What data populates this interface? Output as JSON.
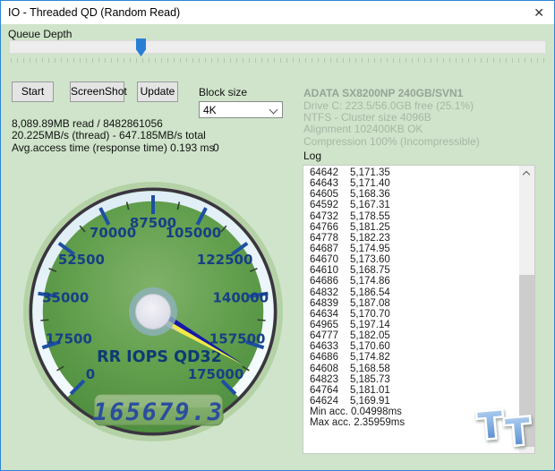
{
  "window": {
    "title": "IO - Threaded QD (Random Read)",
    "close_glyph": "✕"
  },
  "queue_depth": {
    "label": "Queue Depth",
    "thumb_pct": 24.5
  },
  "buttons": {
    "start": "Start",
    "screenshot": "ScreenShot",
    "update": "Update"
  },
  "block_size": {
    "label": "Block size",
    "value": "4K"
  },
  "stats": {
    "read": "8,089.89MB read / 8482861056",
    "speed": "20.225MB/s (thread) - 647.185MB/s total",
    "access": "Avg.access time (response time) 0.193 ms",
    "counter": "0"
  },
  "drive_info": {
    "title": "ADATA SX8200NP 240GB/SVN1",
    "lines": [
      "Drive C: 223.5/56.0GB free (25.1%)",
      "NTFS - Cluster size 4096B",
      "Alignment 102400KB OK",
      "Compression 100% (Incompressible)"
    ]
  },
  "log": {
    "label": "Log",
    "entries": [
      [
        "64642",
        "5,171.35"
      ],
      [
        "64643",
        "5,171.40"
      ],
      [
        "64605",
        "5,168.36"
      ],
      [
        "64592",
        "5,167.31"
      ],
      [
        "64732",
        "5,178.55"
      ],
      [
        "64766",
        "5,181.25"
      ],
      [
        "64778",
        "5,182.23"
      ],
      [
        "64687",
        "5,174.95"
      ],
      [
        "64670",
        "5,173.60"
      ],
      [
        "64610",
        "5,168.75"
      ],
      [
        "64686",
        "5,174.86"
      ],
      [
        "64832",
        "5,186.54"
      ],
      [
        "64839",
        "5,187.08"
      ],
      [
        "64634",
        "5,170.70"
      ],
      [
        "64965",
        "5,197.14"
      ],
      [
        "64777",
        "5,182.05"
      ],
      [
        "64633",
        "5,170.60"
      ],
      [
        "64686",
        "5,174.82"
      ],
      [
        "64608",
        "5,168.58"
      ],
      [
        "64823",
        "5,185.73"
      ],
      [
        "64764",
        "5,181.01"
      ],
      [
        "64624",
        "5,169.91"
      ]
    ],
    "footer": [
      "Min acc. 0.04998ms",
      "Max acc. 2.35959ms"
    ]
  },
  "watermark": {
    "letters": [
      "T",
      "T"
    ]
  },
  "chart_data": {
    "type": "gauge",
    "title": "RR IOPS QD32",
    "min": 0,
    "max": 175000,
    "major_tick_step": 17500,
    "tick_labels": [
      "0",
      "17500",
      "35000",
      "52500",
      "70000",
      "87500",
      "105000",
      "122500",
      "140000",
      "157500",
      "175000"
    ],
    "value": 165679.3,
    "display_value": "165679.3",
    "start_angle_deg": 225,
    "sweep_deg": 270,
    "colors": {
      "face": "#63a04e",
      "band": "#e6eef5",
      "tick_major": "#1d4fa3",
      "tick_minor": "#31422e",
      "label": "#173f85",
      "needle_top": "#1717a8",
      "needle_bottom": "#f0e84a",
      "needle_base": "#c9c0dd",
      "lcd_text": "#2b4d9e"
    }
  }
}
